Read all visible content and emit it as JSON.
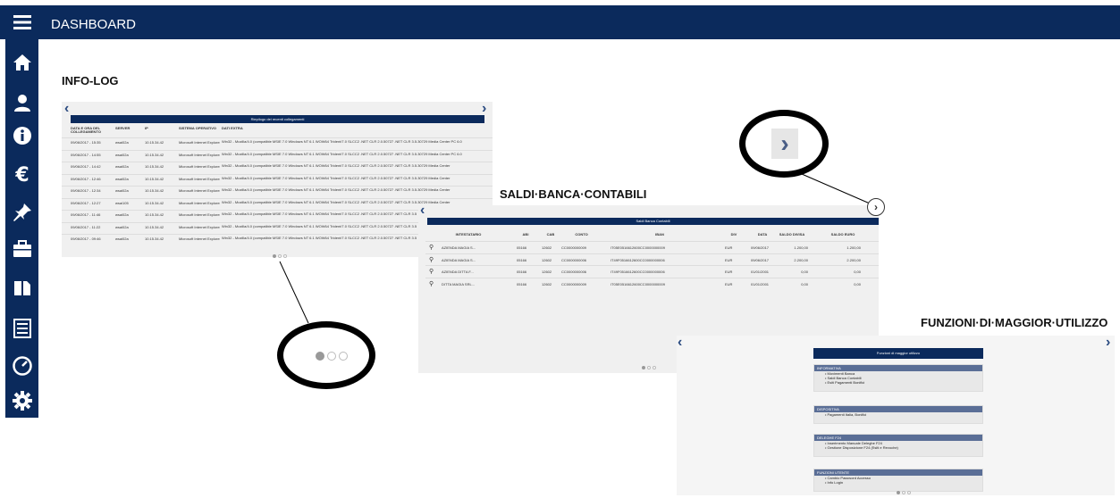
{
  "header": {
    "title": "DASHBOARD",
    "menu_icon": "hamburger-icon"
  },
  "sidebar": {
    "items": [
      {
        "icon": "home-icon"
      },
      {
        "icon": "user-icon"
      },
      {
        "icon": "info-icon"
      },
      {
        "icon": "euro-icon"
      },
      {
        "icon": "pin-icon"
      },
      {
        "icon": "briefcase-icon"
      },
      {
        "icon": "documents-icon"
      },
      {
        "icon": "list-icon"
      },
      {
        "icon": "speedometer-icon"
      },
      {
        "icon": "gear-icon"
      }
    ]
  },
  "infolog": {
    "title": "INFO-LOG",
    "table_title": "Riepilogo dei recenti collegamenti",
    "columns": [
      "DATA E ORA DEL COLLEGAMENTO",
      "SERVER",
      "IP",
      "SISTEMA OPERATIVO",
      "DATI EXTRA"
    ],
    "rows": [
      [
        "09/06/2017 - 15:35",
        "wsai02a",
        "10.15.34.42",
        "Microsoft Internet Explorer",
        "Win32 - Mozilla/4.0 (compatible MSIE 7.0 Windows NT 6.1 WOW64 Trident/7.0 SLCC2 .NET CLR 2.0.50727 .NET CLR 3.5.30729 Media Center PC 6.0"
      ],
      [
        "09/06/2017 - 14:55",
        "wsai02a",
        "10.15.34.42",
        "Microsoft Internet Explorer",
        "Win32 - Mozilla/4.0 (compatible MSIE 7.0 Windows NT 6.1 WOW64 Trident/7.0 SLCC2 .NET CLR 2.0.50727 .NET CLR 3.5.30729 Media Center PC 6.0"
      ],
      [
        "09/06/2017 - 14:42",
        "wsai02a",
        "10.15.34.42",
        "Microsoft Internet Explorer",
        "Win32 - Mozilla/4.0 (compatible MSIE 7.0 Windows NT 6.1 WOW64 Trident/7.0 SLCC2 .NET CLR 2.0.50727 .NET CLR 3.5.30729 Media Center"
      ],
      [
        "09/06/2017 - 12:46",
        "wsai02a",
        "10.15.34.42",
        "Microsoft Internet Explorer",
        "Win32 - Mozilla/4.0 (compatible MSIE 7.0 Windows NT 6.1 WOW64 Trident/7.0 SLCC2 .NET CLR 2.0.50727 .NET CLR 3.5.30729 Media Center"
      ],
      [
        "09/06/2017 - 12:34",
        "wsai02a",
        "10.15.34.42",
        "Microsoft Internet Explorer",
        "Win32 - Mozilla/4.0 (compatible MSIE 7.0 Windows NT 6.1 WOW64 Trident/7.0 SLCC2 .NET CLR 2.0.50727 .NET CLR 3.5.30729 Media Center"
      ],
      [
        "09/06/2017 - 12:27",
        "wsai105",
        "10.15.34.42",
        "Microsoft Internet Explorer",
        "Win32 - Mozilla/4.0 (compatible MSIE 7.0 Windows NT 6.1 WOW64 Trident/7.0 SLCC2 .NET CLR 2.0.50727 .NET CLR 3.5.30729 Media Center"
      ],
      [
        "09/06/2017 - 11:46",
        "wsai02a",
        "10.15.34.42",
        "Microsoft Internet Explorer",
        "Win32 - Mozilla/4.0 (compatible MSIE 7.0 Windows NT 6.1 WOW64 Trident/7.0 SLCC2 .NET CLR 2.0.50727 .NET CLR 3.5"
      ],
      [
        "09/06/2017 - 11:22",
        "wsai02a",
        "10.15.34.42",
        "Microsoft Internet Explorer",
        "Win32 - Mozilla/4.0 (compatible MSIE 7.0 Windows NT 6.1 WOW64 Trident/7.0 SLCC2 .NET CLR 2.0.50727 .NET CLR 3.5"
      ],
      [
        "09/06/2017 - 09:46",
        "wsai02a",
        "10.15.34.42",
        "Microsoft Internet Explorer",
        "Win32 - Mozilla/4.0 (compatible MSIE 7.0 Windows NT 6.1 WOW64 Trident/7.0 SLCC2 .NET CLR 2.0.50727 .NET CLR 3.5"
      ]
    ]
  },
  "saldi": {
    "title": "SALDI·BANCA·CONTABILI",
    "table_title": "Saldi Banca Contabili",
    "columns": [
      "INTESTATARIO",
      "ABI",
      "CAB",
      "CONTO",
      "IBAN",
      "DIV",
      "DATA",
      "SALDO DIVISA",
      "SALDO EURO"
    ],
    "rows": [
      [
        "AZIENDA MAGIA S...",
        "05166",
        "12602",
        "CC0000000009",
        "IT05E0516612600CC0000000009",
        "EUR",
        "09/06/2017",
        "1.200,00",
        "1.200,00"
      ],
      [
        "AZIENDA MAGIA S...",
        "05166",
        "12602",
        "CC0000000006",
        "IT49F0516612600CC0000000006",
        "EUR",
        "09/06/2017",
        "2.200,00",
        "2.200,00"
      ],
      [
        "AZIENDA DITTA F...",
        "05166",
        "12602",
        "CC0000000006",
        "IT49F0516612600CC0000000006",
        "EUR",
        "01/01/2001",
        "0,00",
        "0,00"
      ],
      [
        "DITTA MAGIA SRL...",
        "05166",
        "12602",
        "CC0000000009",
        "IT05E0516612600CC0000000009",
        "EUR",
        "01/01/2001",
        "0,00",
        "0,00"
      ]
    ]
  },
  "funzioni": {
    "title": "FUNZIONI·DI·MAGGIOR·UTILIZZO",
    "table_title": "Funzioni di maggior utilizzo",
    "groups": [
      {
        "name": "INFORMATIVA",
        "items": [
          "Movimenti Banca",
          "Saldi Banca Contabili",
          "Esiti Pagamenti Bonifici"
        ]
      },
      {
        "name": "DISPOSITIVA",
        "items": [
          "Pagamenti Italia, Bonifici"
        ]
      },
      {
        "name": "DELEGHE F24",
        "items": [
          "Inserimento Manuale Deleghe F24",
          "Gestione Disposizione F24 (Esiti e Revoche)"
        ]
      },
      {
        "name": "FUNZIONI UTENTE",
        "items": [
          "Cambio Password Accesso",
          "Info Login"
        ]
      }
    ]
  },
  "colors": {
    "navy": "#0b2a5c",
    "panel": "#f0f0f0",
    "group_header": "#5a6e96"
  }
}
